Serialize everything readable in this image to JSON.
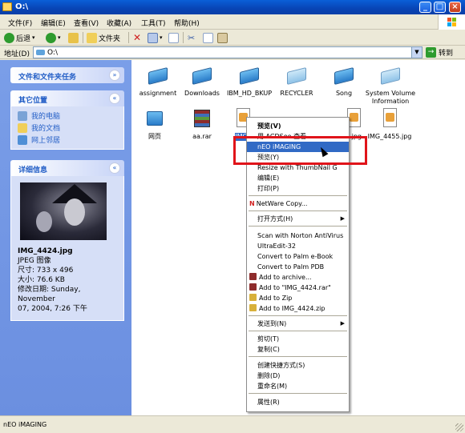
{
  "window": {
    "title": "O:\\"
  },
  "menu": [
    "文件(F)",
    "编辑(E)",
    "查看(V)",
    "收藏(A)",
    "工具(T)",
    "帮助(H)"
  ],
  "toolbar": {
    "back_label": "后退",
    "folders_label": "文件夹"
  },
  "address": {
    "label": "地址(D)",
    "value": "O:\\",
    "go_label": "转到"
  },
  "left": {
    "tasks_title": "文件和文件夹任务",
    "places_title": "其它位置",
    "places": [
      "我的电脑",
      "我的文档",
      "网上邻居"
    ],
    "details_title": "详细信息",
    "details": {
      "filename": "IMG_4424.jpg",
      "type": "JPEG 图像",
      "dimensions": "尺寸: 733 x 496",
      "size": "大小: 76.6 KB",
      "modified_1": "修改日期: Sunday, November",
      "modified_2": "07, 2004, 7:26 下午"
    }
  },
  "files": [
    {
      "name": "assignment"
    },
    {
      "name": "Downloads"
    },
    {
      "name": "IBM_HD_BKUP"
    },
    {
      "name": "RECYCLER"
    },
    {
      "name": "Song"
    },
    {
      "name": "System Volume Information"
    },
    {
      "name": "网页"
    },
    {
      "name": "aa.rar"
    },
    {
      "name": "IMG_"
    },
    {
      "name": "3.jpg"
    },
    {
      "name": "IMG_4455.jpg"
    }
  ],
  "context_menu": {
    "items": [
      "预览(V)",
      "用 ACDSee 查看",
      "nEO iMAGING",
      "预览(Y)",
      "Resize with ThumbNail G",
      "编辑(E)",
      "打印(P)",
      "NetWare Copy...",
      "打开方式(H)",
      "Scan with Norton AntiVirus",
      "UltraEdit-32",
      "Convert to Palm e-Book",
      "Convert to Palm PDB",
      "Add to archive...",
      "Add to \"IMG_4424.rar\"",
      "Add to Zip",
      "Add to IMG_4424.zip",
      "发送到(N)",
      "剪切(T)",
      "复制(C)",
      "创建快捷方式(S)",
      "删除(D)",
      "重命名(M)",
      "属性(R)"
    ]
  },
  "status": {
    "text": "nEO iMAGING"
  },
  "colors": {
    "accent": "#316ac5",
    "highlight_box": "#e0141a",
    "title_bar": "#0a5fd8"
  }
}
